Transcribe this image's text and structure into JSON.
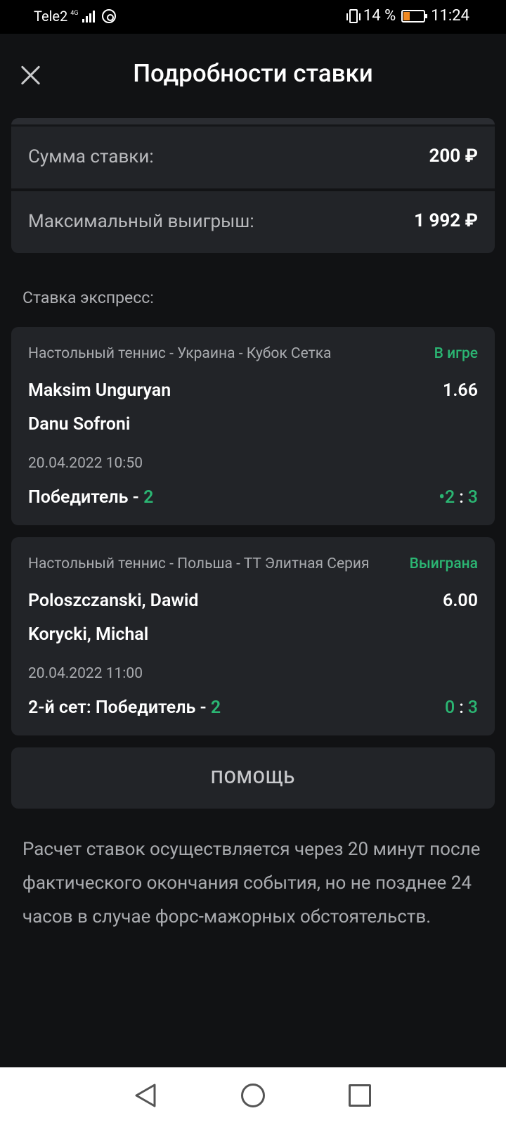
{
  "status_bar": {
    "carrier": "Tele2",
    "network": "4G",
    "battery_percent_text": "14 %",
    "battery_level": 0.14,
    "time": "11:24"
  },
  "header": {
    "title": "Подробности ставки",
    "close_icon": "close-icon"
  },
  "summary": {
    "stake_label": "Сумма ставки:",
    "stake_value": "200 ₽",
    "max_win_label": "Максимальный выигрыш:",
    "max_win_value": "1 992 ₽"
  },
  "section_title": "Ставка экспресс:",
  "events": [
    {
      "league": "Настольный теннис - Украина - Кубок Сетка",
      "status": "В игре",
      "team1": "Maksim Unguryan",
      "team2": "Danu Sofroni",
      "odds": "1.66",
      "datetime": "20.04.2022 10:50",
      "market": "Победитель - ",
      "pick": "2",
      "score_left": "•2",
      "score_sep": ":",
      "score_right": "3"
    },
    {
      "league": "Настольный теннис - Польша - ТТ Элитная Серия",
      "status": "Выиграна",
      "team1": "Poloszczanski, Dawid",
      "team2": "Korycki, Michal",
      "odds": "6.00",
      "datetime": "20.04.2022 11:00",
      "market": "2-й сет: Победитель - ",
      "pick": "2",
      "score_left": "0",
      "score_sep": ":",
      "score_right": "3"
    }
  ],
  "help_button": "ПОМОЩЬ",
  "disclaimer": "Расчет ставок осуществляется через 20 минут после фактического окончания события, но не позднее 24 часов в случае форс-мажорных обстоятельств.",
  "colors": {
    "background": "#111214",
    "card": "#222428",
    "accent_green": "#2bb673"
  },
  "nav_bar": {
    "back_icon": "back-triangle-icon",
    "home_icon": "home-circle-icon",
    "recent_icon": "recent-square-icon"
  }
}
